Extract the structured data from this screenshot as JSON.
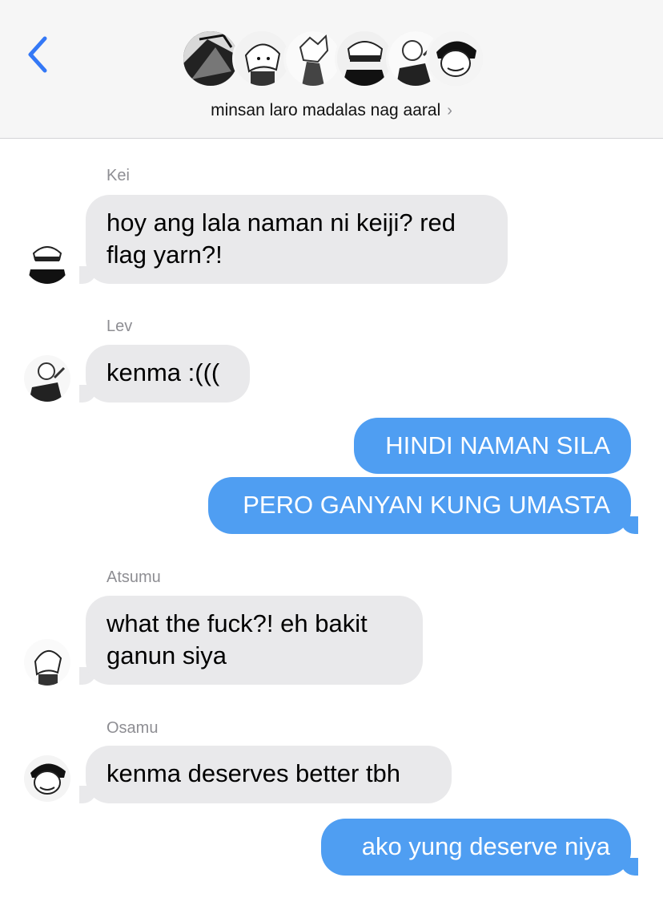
{
  "header": {
    "group_name": "minsan laro madalas nag aaral",
    "chevron": "›",
    "back_icon": "chevron-left-icon",
    "accent_color": "#3478f6"
  },
  "messages": [
    {
      "sender": "Kei",
      "text": "hoy ang lala naman ni keiji? red\nflag yarn?!",
      "direction": "incoming"
    },
    {
      "sender": "Lev",
      "text": "kenma :(((",
      "direction": "incoming"
    },
    {
      "text": "HINDI NAMAN SILA",
      "direction": "outgoing"
    },
    {
      "text": "PERO GANYAN KUNG UMASTA",
      "direction": "outgoing"
    },
    {
      "sender": "Atsumu",
      "text": "what the fuck?! eh bakit\nganun siya",
      "direction": "incoming"
    },
    {
      "sender": "Osamu",
      "text": "kenma deserves better tbh",
      "direction": "incoming"
    },
    {
      "text": "ako yung deserve niya",
      "direction": "outgoing"
    }
  ],
  "colors": {
    "incoming_bubble": "#e9e9eb",
    "outgoing_bubble": "#4f9ef2",
    "header_bg": "#f6f6f6",
    "sender_label": "#8e8e93"
  }
}
